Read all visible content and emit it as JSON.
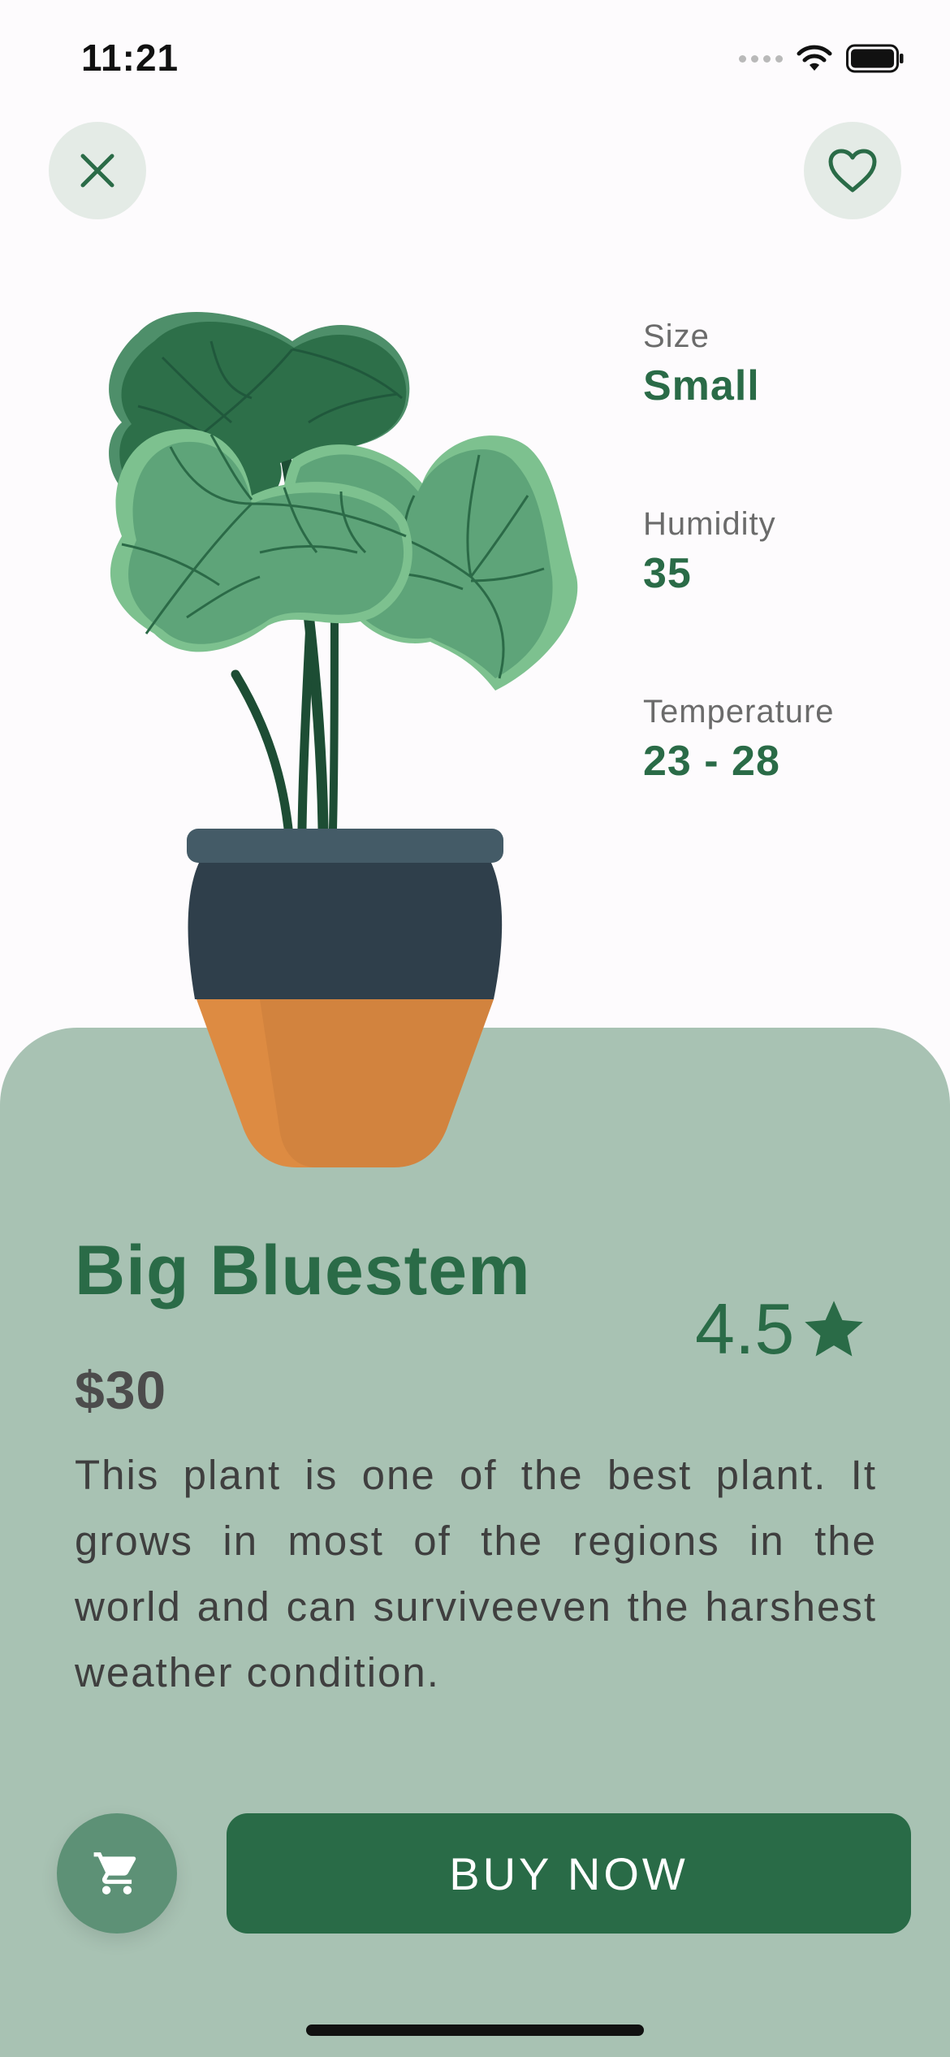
{
  "status_bar": {
    "time": "11:21"
  },
  "header": {
    "close_icon": "close-icon",
    "favorite_icon": "heart-outline-icon"
  },
  "specs": [
    {
      "label": "Size",
      "value": "Small"
    },
    {
      "label": "Humidity",
      "value": "35"
    },
    {
      "label": "Temperature",
      "value": "23 - 28"
    }
  ],
  "product": {
    "name": "Big Bluestem",
    "rating": "4.5",
    "price": "$30",
    "description": "This plant is one of the best plant. It grows in most of the regions in the world and can surviveeven the harshest weather condition."
  },
  "actions": {
    "cart_icon": "cart-icon",
    "buy_label": "BUY NOW"
  },
  "colors": {
    "primary": "#296b47",
    "sheet": "#a8c2b3",
    "button_light": "#e4ebe6",
    "cart_button": "#5d9176",
    "background": "#fdfbfd"
  }
}
